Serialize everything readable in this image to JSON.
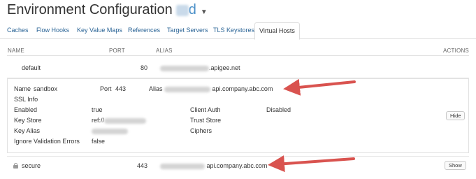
{
  "page": {
    "title": "Environment Configuration",
    "env_suffix": "d"
  },
  "tabs": [
    {
      "label": "Caches"
    },
    {
      "label": "Flow Hooks"
    },
    {
      "label": "Key Value Maps"
    },
    {
      "label": "References"
    },
    {
      "label": "Target Servers"
    },
    {
      "label": "TLS Keystores"
    },
    {
      "label": "Virtual Hosts",
      "active": true
    }
  ],
  "columns": {
    "name": "NAME",
    "port": "PORT",
    "alias": "ALIAS",
    "actions": "ACTIONS"
  },
  "default_row": {
    "name": "default",
    "port": "80",
    "alias_suffix": ".apigee.net"
  },
  "detail": {
    "name_label": "Name",
    "name_value": "sandbox",
    "port_label": "Port",
    "port_value": "443",
    "alias_label": "Alias",
    "alias_value": "api.company.abc.com",
    "ssl_info_label": "SSL Info",
    "enabled_label": "Enabled",
    "enabled_value": "true",
    "client_auth_label": "Client Auth",
    "client_auth_value": "Disabled",
    "key_store_label": "Key Store",
    "key_store_prefix": "ref://",
    "trust_store_label": "Trust Store",
    "key_alias_label": "Key Alias",
    "ciphers_label": "Ciphers",
    "ignore_label": "Ignore Validation Errors",
    "ignore_value": "false",
    "hide_label": "Hide"
  },
  "secure_row": {
    "name": "secure",
    "port": "443",
    "alias_value": "api.company.abc.com",
    "show_label": "Show"
  },
  "colors": {
    "link": "#2a6496",
    "arrow": "#d9534f"
  }
}
